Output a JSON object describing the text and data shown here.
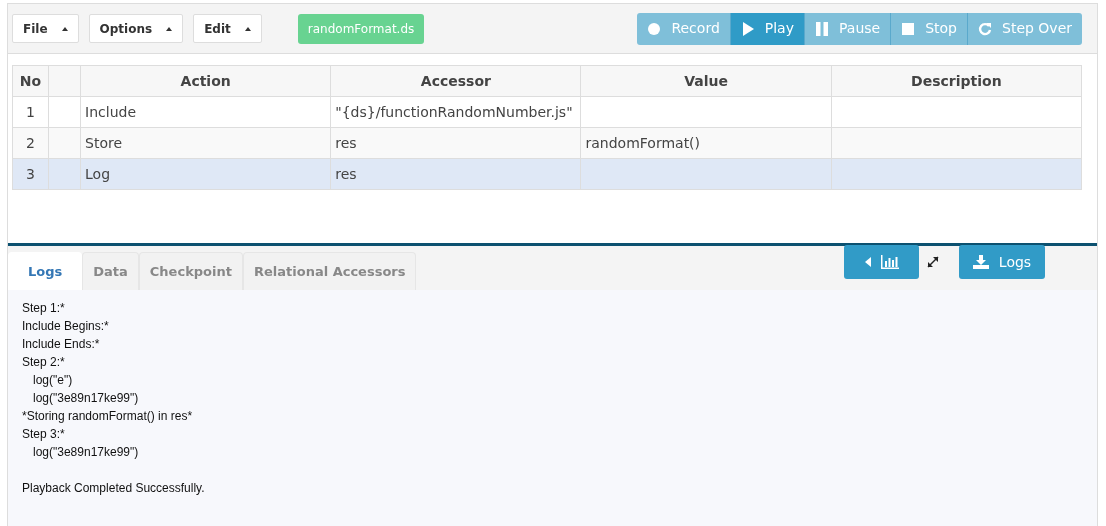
{
  "menus": [
    {
      "label": "File"
    },
    {
      "label": "Options"
    },
    {
      "label": "Edit"
    }
  ],
  "file_badge": "randomFormat.ds",
  "player_buttons": [
    {
      "kind": "record",
      "label": "Record",
      "selected": false
    },
    {
      "kind": "play",
      "label": "Play",
      "selected": true
    },
    {
      "kind": "pause",
      "label": "Pause",
      "selected": false
    },
    {
      "kind": "stop",
      "label": "Stop",
      "selected": false
    },
    {
      "kind": "stepover",
      "label": "Step Over",
      "selected": false
    }
  ],
  "table": {
    "columns": [
      "No",
      "Action",
      "Accessor",
      "Value",
      "Description"
    ],
    "rows": [
      {
        "no": "1",
        "action": "Include",
        "accessor": "\"{ds}/functionRandomNumber.js\"",
        "selected": false
      },
      {
        "no": "2",
        "action": "Store",
        "accessor": "res",
        "value": "randomFormat()",
        "selected": false
      },
      {
        "no": "3",
        "action": "Log",
        "accessor": "res",
        "selected": true
      }
    ]
  },
  "tabs": [
    {
      "label": "Logs",
      "selected": true
    },
    {
      "label": "Data",
      "selected": false
    },
    {
      "label": "Checkpoint",
      "selected": false
    },
    {
      "label": "Relational Accessors",
      "selected": false
    }
  ],
  "download_button": "Logs",
  "log": [
    {
      "text": "Step 1:*"
    },
    {
      "text": "Include Begins:*"
    },
    {
      "text": "Include Ends:*"
    },
    {
      "text": "Step 2:*",
      "children": [
        {
          "text": "log(\"e\")"
        },
        {
          "text": "log(\"3e89n17ke99\")"
        }
      ]
    },
    {
      "text": "*Storing randomFormat() in res*"
    },
    {
      "text": "Step 3:*",
      "children": [
        {
          "text": "log(\"3e89n17ke99\")"
        }
      ]
    }
  ],
  "log_footer": "Playback Completed Successfully."
}
